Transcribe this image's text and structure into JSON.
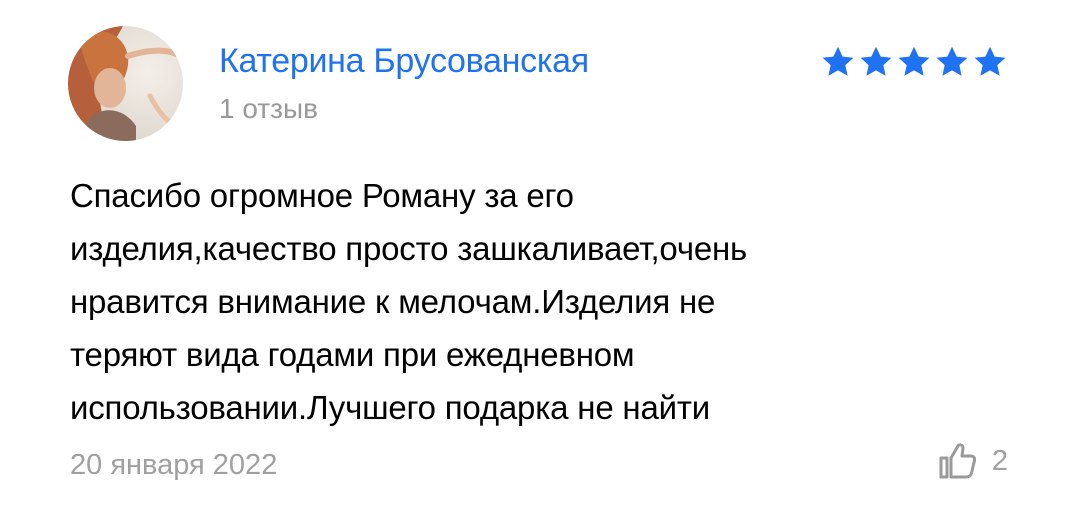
{
  "colors": {
    "accent": "#1f72f2",
    "star": "#1f72f2",
    "muted": "#999999",
    "text": "#000000"
  },
  "review": {
    "author": {
      "name": "Катерина Брусованская",
      "review_count": "1 отзыв",
      "avatar": "user-photo"
    },
    "rating": 5,
    "rating_max": 5,
    "text_lines": [
      "Спасибо огромное Роману за его",
      "изделия,качество просто зашкаливает,очень",
      "нравится внимание к мелочам.Изделия не",
      "теряют вида годами при ежедневном",
      "использовании.Лучшего подарка не найти"
    ],
    "date": "20 января 2022",
    "like_icon": "thumbs-up-icon",
    "likes": "2"
  }
}
